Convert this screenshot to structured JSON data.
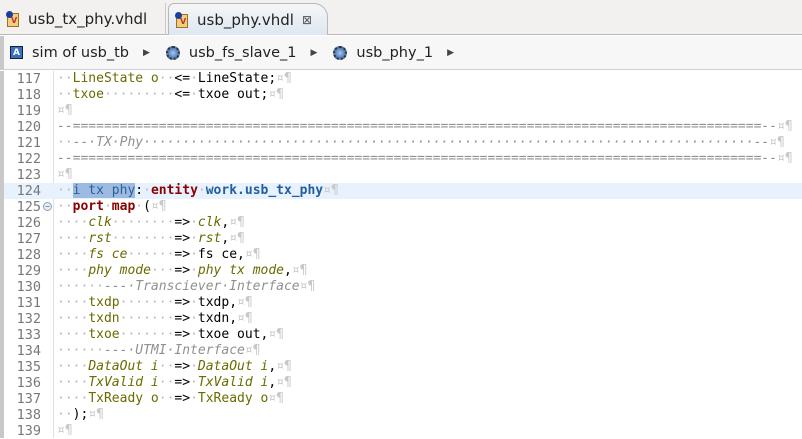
{
  "tabs": [
    {
      "label": "usb_tx_phy.vhdl",
      "active": false
    },
    {
      "label": "usb_phy.vhdl",
      "active": true,
      "close": "⊠"
    }
  ],
  "breadcrumb": [
    {
      "label": "sim of usb_tb",
      "icon": "architecture-icon"
    },
    {
      "label": "usb_fs_slave_1",
      "icon": "entity-instance-icon"
    },
    {
      "label": "usb_phy_1",
      "icon": "entity-instance-icon"
    }
  ],
  "editor": {
    "highlight_line": 124,
    "fold_line": 125,
    "lines": [
      {
        "n": "117",
        "t": [
          [
            "w",
            "··"
          ],
          [
            "s",
            "LineState o"
          ],
          [
            "w",
            "··"
          ],
          [
            "p",
            "<="
          ],
          [
            "w",
            "·"
          ],
          [
            "p",
            "LineState;"
          ],
          [
            "m",
            "¤¶"
          ]
        ]
      },
      {
        "n": "118",
        "t": [
          [
            "w",
            "··"
          ],
          [
            "s",
            "txoe"
          ],
          [
            "w",
            "·········"
          ],
          [
            "p",
            "<="
          ],
          [
            "w",
            "·"
          ],
          [
            "p",
            "txoe out;"
          ],
          [
            "m",
            "¤¶"
          ]
        ]
      },
      {
        "n": "119",
        "t": [
          [
            "m",
            "¤¶"
          ]
        ]
      },
      {
        "n": "120",
        "t": [
          [
            "c",
            "--========================================================================================--"
          ],
          [
            "m",
            "¤¶"
          ]
        ]
      },
      {
        "n": "121",
        "t": [
          [
            "w",
            "··"
          ],
          [
            "c",
            "--·TX·Phy··············································································--"
          ],
          [
            "m",
            "¤¶"
          ]
        ]
      },
      {
        "n": "122",
        "t": [
          [
            "c",
            "--========================================================================================--"
          ],
          [
            "m",
            "¤¶"
          ]
        ]
      },
      {
        "n": "123",
        "t": [
          [
            "m",
            "¤¶"
          ]
        ]
      },
      {
        "n": "124",
        "t": [
          [
            "w",
            "··"
          ],
          [
            "sel",
            "i tx phy"
          ],
          [
            "p",
            ":"
          ],
          [
            "w",
            "·"
          ],
          [
            "k",
            "entity"
          ],
          [
            "w",
            "·"
          ],
          [
            "e",
            "work.usb_tx_phy"
          ],
          [
            "m",
            "¤¶"
          ]
        ]
      },
      {
        "n": "125",
        "t": [
          [
            "w",
            "··"
          ],
          [
            "k",
            "port"
          ],
          [
            "w",
            "·"
          ],
          [
            "k",
            "map"
          ],
          [
            "w",
            "·"
          ],
          [
            "p",
            "("
          ],
          [
            "m",
            "¤¶"
          ]
        ]
      },
      {
        "n": "126",
        "t": [
          [
            "w",
            "····"
          ],
          [
            "si",
            "clk"
          ],
          [
            "w",
            "········"
          ],
          [
            "p",
            "=>"
          ],
          [
            "w",
            "·"
          ],
          [
            "si",
            "clk"
          ],
          [
            "p",
            ","
          ],
          [
            "m",
            "¤¶"
          ]
        ]
      },
      {
        "n": "127",
        "t": [
          [
            "w",
            "····"
          ],
          [
            "si",
            "rst"
          ],
          [
            "w",
            "········"
          ],
          [
            "p",
            "=>"
          ],
          [
            "w",
            "·"
          ],
          [
            "si",
            "rst"
          ],
          [
            "p",
            ","
          ],
          [
            "m",
            "¤¶"
          ]
        ]
      },
      {
        "n": "128",
        "t": [
          [
            "w",
            "····"
          ],
          [
            "si",
            "fs ce"
          ],
          [
            "w",
            "······"
          ],
          [
            "p",
            "=>"
          ],
          [
            "w",
            "·"
          ],
          [
            "p",
            "fs ce,"
          ],
          [
            "m",
            "¤¶"
          ]
        ]
      },
      {
        "n": "129",
        "t": [
          [
            "w",
            "····"
          ],
          [
            "si",
            "phy mode"
          ],
          [
            "w",
            "···"
          ],
          [
            "p",
            "=>"
          ],
          [
            "w",
            "·"
          ],
          [
            "si",
            "phy tx mode"
          ],
          [
            "p",
            ","
          ],
          [
            "m",
            "¤¶"
          ]
        ]
      },
      {
        "n": "130",
        "t": [
          [
            "w",
            "······"
          ],
          [
            "c",
            "---·Transciever·Interface"
          ],
          [
            "m",
            "¤¶"
          ]
        ]
      },
      {
        "n": "131",
        "t": [
          [
            "w",
            "····"
          ],
          [
            "s",
            "txdp"
          ],
          [
            "w",
            "·······"
          ],
          [
            "p",
            "=>"
          ],
          [
            "w",
            "·"
          ],
          [
            "p",
            "txdp,"
          ],
          [
            "m",
            "¤¶"
          ]
        ]
      },
      {
        "n": "132",
        "t": [
          [
            "w",
            "····"
          ],
          [
            "s",
            "txdn"
          ],
          [
            "w",
            "·······"
          ],
          [
            "p",
            "=>"
          ],
          [
            "w",
            "·"
          ],
          [
            "p",
            "txdn,"
          ],
          [
            "m",
            "¤¶"
          ]
        ]
      },
      {
        "n": "133",
        "t": [
          [
            "w",
            "····"
          ],
          [
            "s",
            "txoe"
          ],
          [
            "w",
            "·······"
          ],
          [
            "p",
            "=>"
          ],
          [
            "w",
            "·"
          ],
          [
            "p",
            "txoe out,"
          ],
          [
            "m",
            "¤¶"
          ]
        ]
      },
      {
        "n": "134",
        "t": [
          [
            "w",
            "······"
          ],
          [
            "c",
            "---·UTMI·Interface"
          ],
          [
            "m",
            "¤¶"
          ]
        ]
      },
      {
        "n": "135",
        "t": [
          [
            "w",
            "····"
          ],
          [
            "si",
            "DataOut i"
          ],
          [
            "w",
            "··"
          ],
          [
            "p",
            "=>"
          ],
          [
            "w",
            "·"
          ],
          [
            "si",
            "DataOut i"
          ],
          [
            "p",
            ","
          ],
          [
            "m",
            "¤¶"
          ]
        ]
      },
      {
        "n": "136",
        "t": [
          [
            "w",
            "····"
          ],
          [
            "si",
            "TxValid i"
          ],
          [
            "w",
            "··"
          ],
          [
            "p",
            "=>"
          ],
          [
            "w",
            "·"
          ],
          [
            "si",
            "TxValid i"
          ],
          [
            "p",
            ","
          ],
          [
            "m",
            "¤¶"
          ]
        ]
      },
      {
        "n": "137",
        "t": [
          [
            "w",
            "····"
          ],
          [
            "s",
            "TxReady o"
          ],
          [
            "w",
            "··"
          ],
          [
            "p",
            "=>"
          ],
          [
            "w",
            "·"
          ],
          [
            "s",
            "TxReady o"
          ],
          [
            "m",
            "¤¶"
          ]
        ]
      },
      {
        "n": "138",
        "t": [
          [
            "w",
            "··"
          ],
          [
            "p",
            ");"
          ],
          [
            "m",
            "¤¶"
          ]
        ]
      },
      {
        "n": "139",
        "t": [
          [
            "m",
            "¤¶"
          ]
        ]
      }
    ]
  }
}
